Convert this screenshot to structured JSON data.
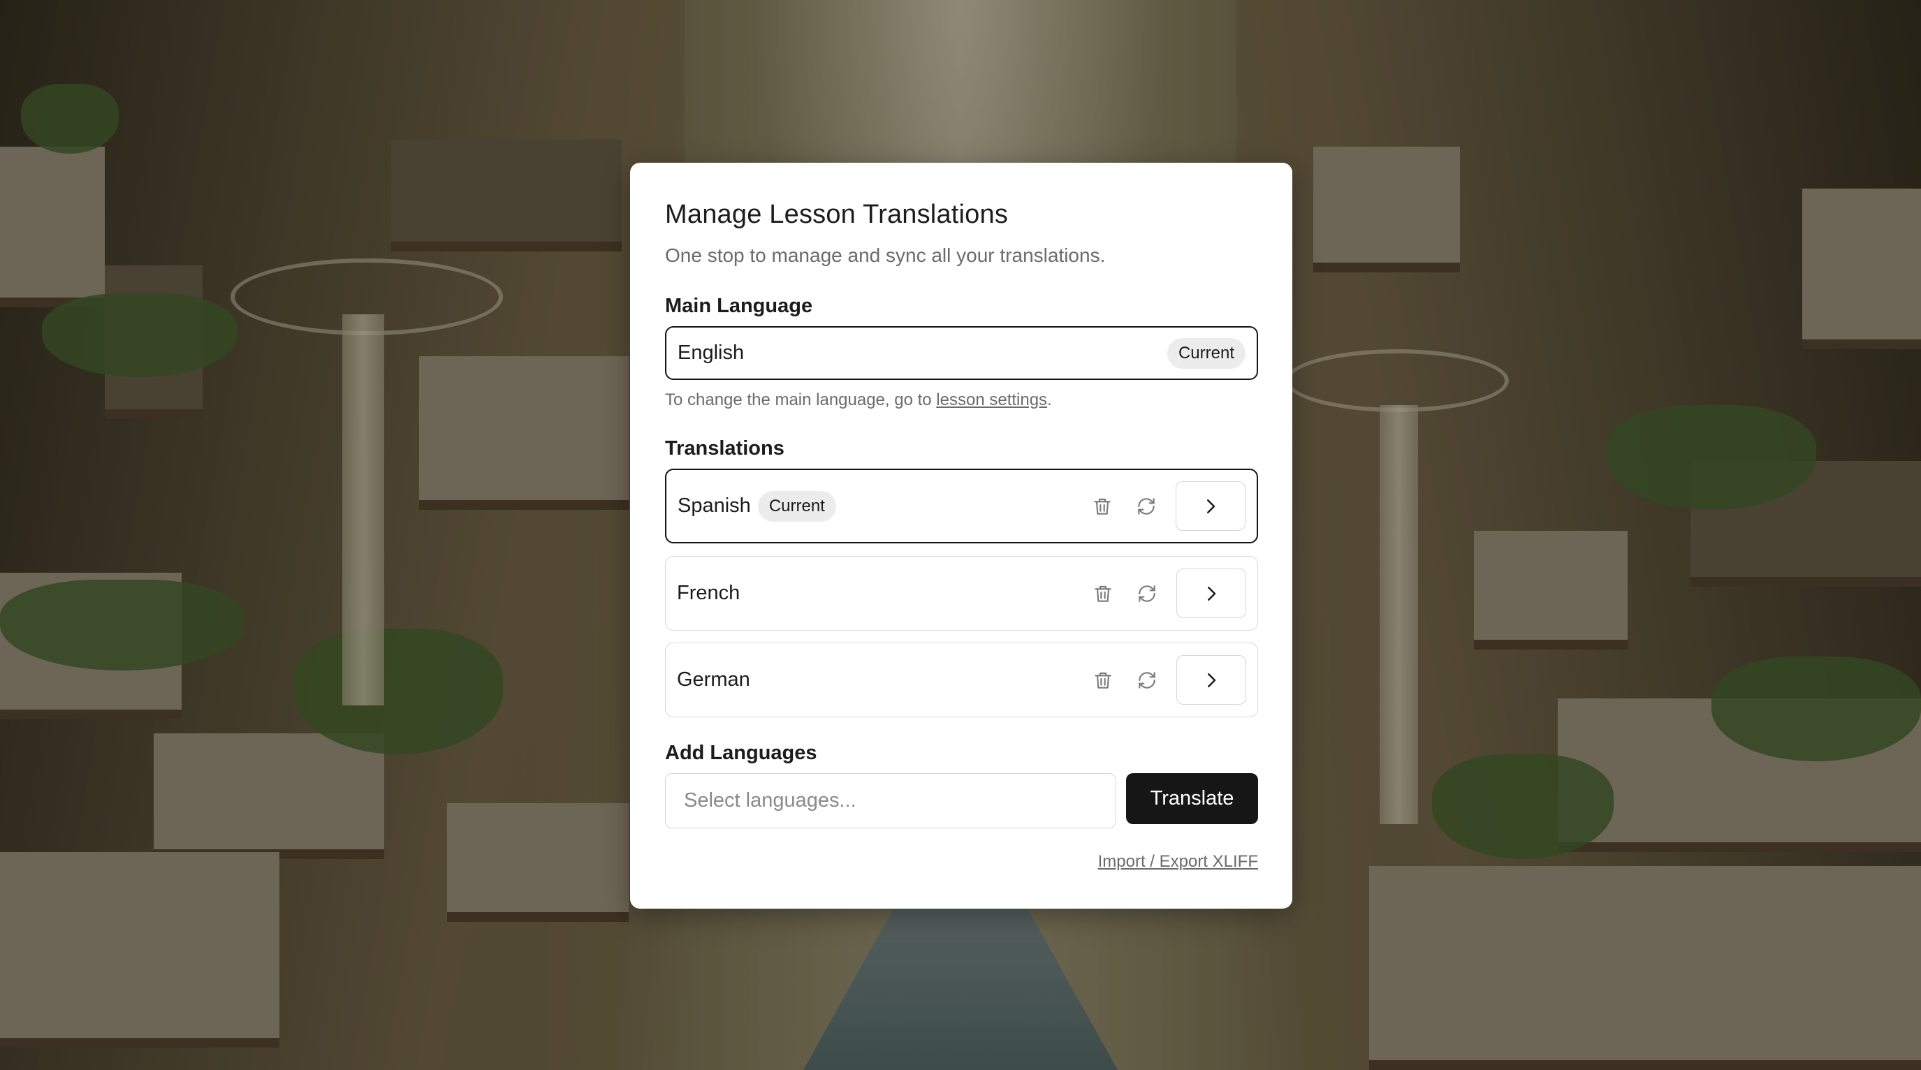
{
  "dialog": {
    "title": "Manage Lesson Translations",
    "subtitle": "One stop to manage and sync all your translations."
  },
  "main_language": {
    "label": "Main Language",
    "value": "English",
    "badge": "Current",
    "hint_prefix": "To change the main language, go to ",
    "hint_link": "lesson settings",
    "hint_suffix": "."
  },
  "translations": {
    "label": "Translations",
    "items": [
      {
        "name": "Spanish",
        "badge": "Current",
        "selected": true
      },
      {
        "name": "French",
        "badge": "",
        "selected": false
      },
      {
        "name": "German",
        "badge": "",
        "selected": false
      }
    ],
    "icons": [
      "trash-icon",
      "sync-icon",
      "chevron-right-icon"
    ]
  },
  "add_languages": {
    "label": "Add Languages",
    "placeholder": "Select languages...",
    "button": "Translate"
  },
  "footer": {
    "link": "Import / Export XLIFF"
  },
  "colors": {
    "primary_button": "#161616",
    "badge_bg": "#ececec",
    "muted_text": "#6b6b6b"
  }
}
